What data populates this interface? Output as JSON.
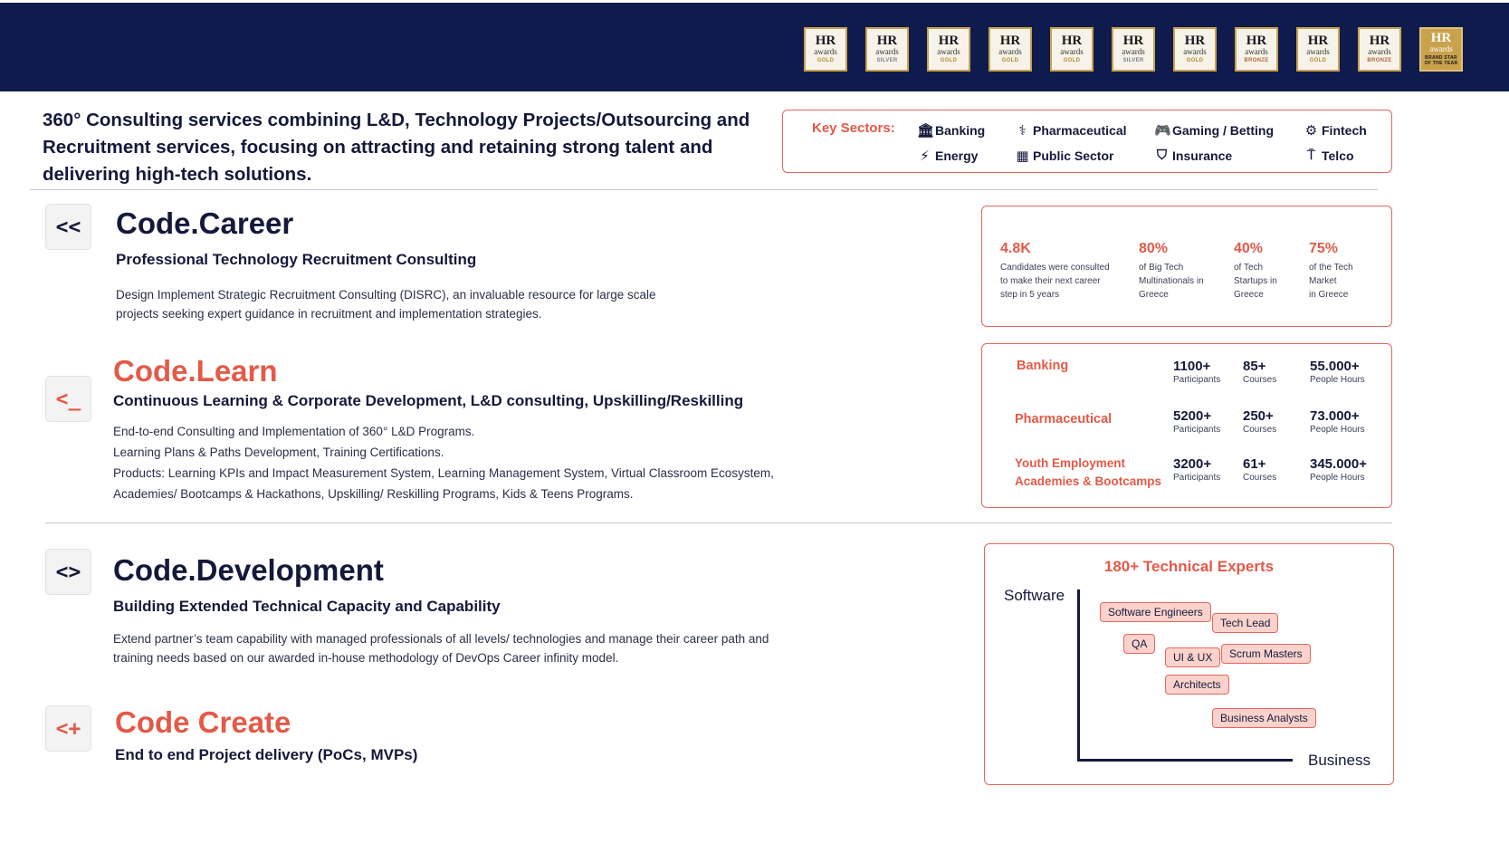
{
  "header": {
    "awards": [
      {
        "icon": "hr-awards-logo",
        "level": "GOLD",
        "type": "gold"
      },
      {
        "icon": "hr-awards-logo",
        "level": "SILVER",
        "type": "silver"
      },
      {
        "icon": "hr-awards-logo",
        "level": "GOLD",
        "type": "gold"
      },
      {
        "icon": "hr-awards-logo",
        "level": "GOLD",
        "type": "gold"
      },
      {
        "icon": "hr-awards-logo",
        "level": "GOLD",
        "type": "gold"
      },
      {
        "icon": "hr-awards-logo",
        "level": "SILVER",
        "type": "silver"
      },
      {
        "icon": "hr-awards-logo",
        "level": "GOLD",
        "type": "gold"
      },
      {
        "icon": "hr-awards-logo",
        "level": "BRONZE",
        "type": "bronze"
      },
      {
        "icon": "hr-awards-logo",
        "level": "GOLD",
        "type": "gold"
      },
      {
        "icon": "hr-awards-logo",
        "level": "BRONZE",
        "type": "bronze"
      },
      {
        "icon": "hr-awards-logo",
        "level": "BRAND STAR OF THE YEAR",
        "type": "star"
      }
    ],
    "background": "#0f1b4c"
  },
  "intro": "360° Consulting services combining L&D, Technology Projects/Outsourcing and Recruitment services, focusing on attracting and retaining strong talent and delivering high-tech solutions.",
  "sectors": {
    "label": "Key Sectors:",
    "items": [
      {
        "name": "Banking",
        "icon": "bank-icon"
      },
      {
        "name": "Pharmaceutical",
        "icon": "pharmacy-icon"
      },
      {
        "name": "Gaming / Betting",
        "icon": "gamepad-icon"
      },
      {
        "name": "Fintech",
        "icon": "fintech-icon"
      },
      {
        "name": "Energy",
        "icon": "energy-icon"
      },
      {
        "name": "Public Sector",
        "icon": "building-icon"
      },
      {
        "name": "Insurance",
        "icon": "shield-icon"
      },
      {
        "name": "Telco",
        "icon": "antenna-icon"
      }
    ]
  },
  "career": {
    "badge": "<<",
    "title": "Code.Career",
    "subtitle": "Professional Technology Recruitment Consulting",
    "body1": "Design Implement Strategic Recruitment Consulting (DISRC), an invaluable resource for large scale",
    "body2": "projects seeking expert guidance in recruitment and implementation strategies.",
    "stats": [
      {
        "value": "4.8K",
        "l1": "Candidates were consulted",
        "l2": "to make their next career",
        "l3": "step in 5 years"
      },
      {
        "value": "80%",
        "l1": "of Big Tech",
        "l2": "Multinationals in",
        "l3": "Greece"
      },
      {
        "value": "40%",
        "l1": "of Tech",
        "l2": "Startups in",
        "l3": "Greece"
      },
      {
        "value": "75%",
        "l1": "of the Tech",
        "l2": "Market",
        "l3": "in Greece"
      }
    ]
  },
  "learn": {
    "badge": "<_",
    "title": "Code.Learn",
    "subtitle": "Continuous Learning & Corporate Development, L&D consulting, Upskilling/Reskilling",
    "line1": "End-to-end Consulting and Implementation of 360° L&D Programs.",
    "line2": "Learning Plans & Paths Development, Training Certifications.",
    "line3": "Products: Learning KPIs and Impact Measurement System, Learning Management System, Virtual Classroom Ecosystem,",
    "line4": "Academies/ Bootcamps & Hackathons, Upskilling/ Reskilling Programs, Kids & Teens Programs.",
    "rows": [
      {
        "name1": "Banking",
        "name2": "",
        "p": "1100+",
        "pl": "Participants",
        "c": "85+",
        "cl": "Courses",
        "h": "55.000+",
        "hl": "People Hours"
      },
      {
        "name1": "Pharmaceutical",
        "name2": "",
        "p": "5200+",
        "pl": "Participants",
        "c": "250+",
        "cl": "Courses",
        "h": "73.000+",
        "hl": "People Hours"
      },
      {
        "name1": "Youth Employment",
        "name2": "Academies & Bootcamps",
        "p": "3200+",
        "pl": "Participants",
        "c": "61+",
        "cl": "Courses",
        "h": "345.000+",
        "hl": "People Hours"
      }
    ]
  },
  "development": {
    "badge": "<>",
    "title": "Code.Development",
    "subtitle": "Building Extended Technical Capacity and Capability",
    "body1": "Extend partner’s team capability with managed professionals of all levels/ technologies and manage their career path and",
    "body2": "training needs based on our awarded in-house methodology of DevOps Career infinity model.",
    "experts": {
      "title": "180+ Technical Experts",
      "y_label": "Software",
      "x_label": "Business",
      "roles": [
        "Software Engineers",
        "Tech Lead",
        "QA",
        "UI & UX",
        "Scrum Masters",
        "Architects",
        "Business Analysts"
      ]
    }
  },
  "create": {
    "badge": "<+",
    "title": "Code Create",
    "subtitle": "End to end Project delivery (PoCs, MVPs)"
  },
  "colors": {
    "navy": "#14193a",
    "coral": "#e35a48",
    "chip": "#fbd3cc"
  }
}
